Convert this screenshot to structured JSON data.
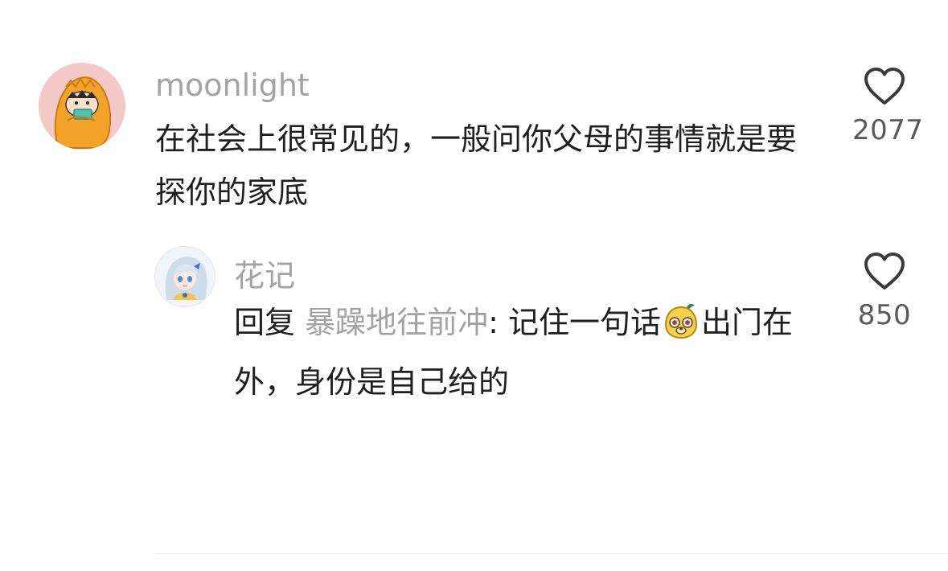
{
  "comment": {
    "username": "moonlight",
    "text": "在社会上很常见的，一般问你父母的事情就是要探你的家底",
    "likes": "2077",
    "avatar_icon": "orange-blanket-kid-avatar-icon",
    "like_icon": "heart-outline-icon"
  },
  "reply": {
    "username": "花记",
    "prefix": "回复",
    "target": "暴躁地往前冲",
    "separator": ": ",
    "text_before_emoji": "记住一句话",
    "emoji_icon": "yellow-dog-face-emoji",
    "text_after_emoji": "出门在外，身份是自己给的",
    "likes": "850",
    "avatar_icon": "anime-girl-avatar-icon",
    "like_icon": "heart-outline-icon"
  },
  "colors": {
    "username": "#a3a3a3",
    "text": "#1f1f1f",
    "count": "#5a5a5a",
    "divider": "#ececec"
  }
}
